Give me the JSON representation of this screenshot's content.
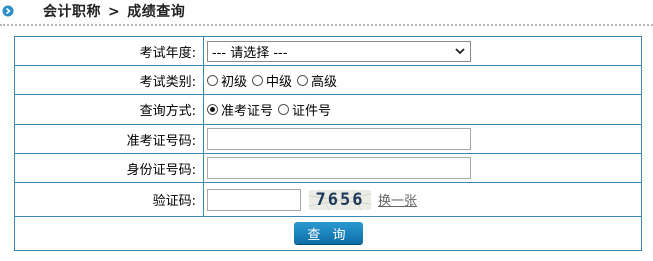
{
  "breadcrumb": {
    "section": "会计职称",
    "separator": ">",
    "page": "成绩查询"
  },
  "form": {
    "year": {
      "label": "考试年度:",
      "selected": "--- 请选择 ---"
    },
    "category": {
      "label": "考试类别:",
      "options": [
        {
          "label": "初级",
          "checked": false
        },
        {
          "label": "中级",
          "checked": false
        },
        {
          "label": "高级",
          "checked": false
        }
      ]
    },
    "method": {
      "label": "查询方式:",
      "options": [
        {
          "label": "准考证号",
          "checked": true
        },
        {
          "label": "证件号",
          "checked": false
        }
      ]
    },
    "ticket": {
      "label": "准考证号码:",
      "value": ""
    },
    "idcard": {
      "label": "身份证号码:",
      "value": ""
    },
    "captcha": {
      "label": "验证码:",
      "value": "",
      "code": "7656",
      "refresh": "换一张"
    },
    "submit": "查 询"
  },
  "colors": {
    "border": "#3b87b2",
    "button": "#1a82bc",
    "bullet": "#2b8ec6"
  },
  "icons": {
    "bullet": "circle-arrow-right-icon",
    "select": "chevron-down-icon"
  }
}
